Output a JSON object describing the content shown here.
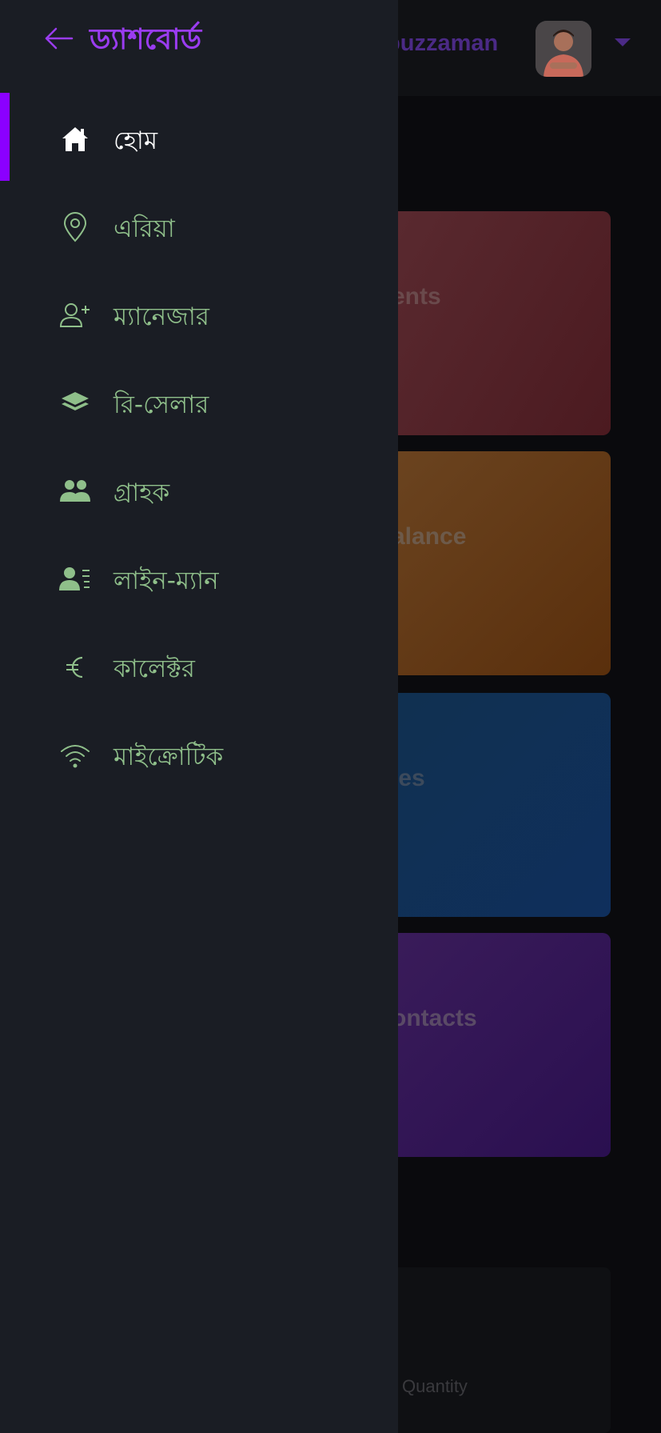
{
  "background": {
    "username": "ibuzzaman",
    "cards": [
      {
        "label": "ents"
      },
      {
        "label": "alance"
      },
      {
        "label": "les"
      },
      {
        "label": "ontacts"
      }
    ],
    "quantity_label": "Quantity"
  },
  "drawer": {
    "title": "ড্যাশবোর্ড",
    "items": [
      {
        "label": "হোম",
        "icon": "home-icon",
        "active": true
      },
      {
        "label": "এরিয়া",
        "icon": "location-pin-icon",
        "active": false
      },
      {
        "label": "ম্যানেজার",
        "icon": "user-plus-icon",
        "active": false
      },
      {
        "label": "রি-সেলার",
        "icon": "layers-icon",
        "active": false
      },
      {
        "label": "গ্রাহক",
        "icon": "users-icon",
        "active": false
      },
      {
        "label": "লাইন-ম্যান",
        "icon": "user-list-icon",
        "active": false
      },
      {
        "label": "কালেক্টর",
        "icon": "euro-icon",
        "active": false
      },
      {
        "label": "মাইক্রোটিক",
        "icon": "wifi-icon",
        "active": false
      }
    ]
  },
  "colors": {
    "accent": "#8b00ff",
    "title": "#9a3cf0",
    "nav_text": "#8fbf8a",
    "drawer_bg": "#1a1d24"
  }
}
